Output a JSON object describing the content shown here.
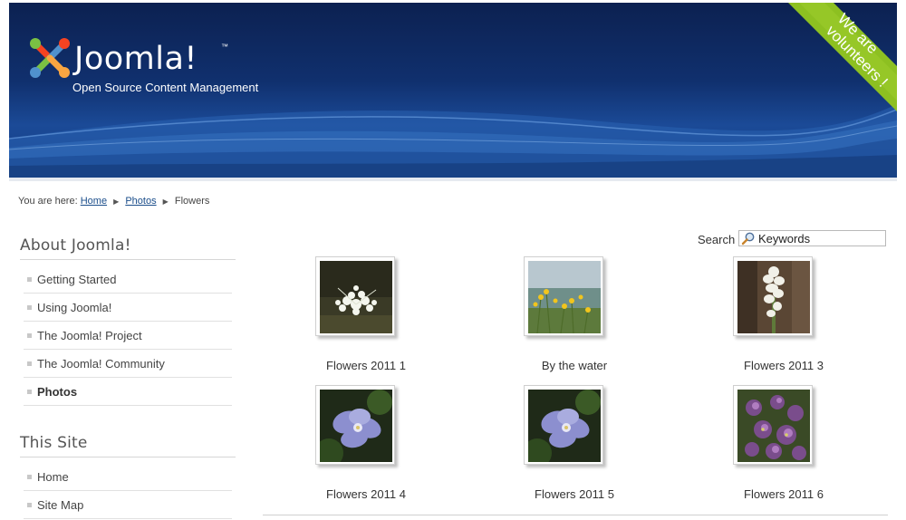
{
  "header": {
    "logo_text": "Joomla!",
    "logo_tm": "™",
    "tagline": "Open Source Content Management",
    "ribbon_line1": "We are",
    "ribbon_line2": "volunteers !"
  },
  "breadcrumb": {
    "prefix": "You are here:",
    "items": [
      "Home",
      "Photos",
      "Flowers"
    ]
  },
  "sidebar": {
    "about_title": "About Joomla!",
    "about_items": [
      {
        "label": "Getting Started"
      },
      {
        "label": "Using Joomla!"
      },
      {
        "label": "The Joomla! Project"
      },
      {
        "label": "The Joomla! Community"
      },
      {
        "label": "Photos",
        "active": true
      }
    ],
    "site_title": "This Site",
    "site_items": [
      {
        "label": "Home"
      },
      {
        "label": "Site Map"
      }
    ]
  },
  "search": {
    "label": "Search",
    "value": "Keywords"
  },
  "gallery": [
    {
      "caption": "Flowers 2011 1"
    },
    {
      "caption": "By the water"
    },
    {
      "caption": "Flowers 2011 3"
    },
    {
      "caption": "Flowers 2011 4"
    },
    {
      "caption": "Flowers 2011 5"
    },
    {
      "caption": "Flowers 2011 6"
    }
  ],
  "colors": {
    "banner_dark": "#0c2151",
    "banner_light": "#1b4a97",
    "ribbon": "#8dc021",
    "link": "#1a4d8a"
  }
}
